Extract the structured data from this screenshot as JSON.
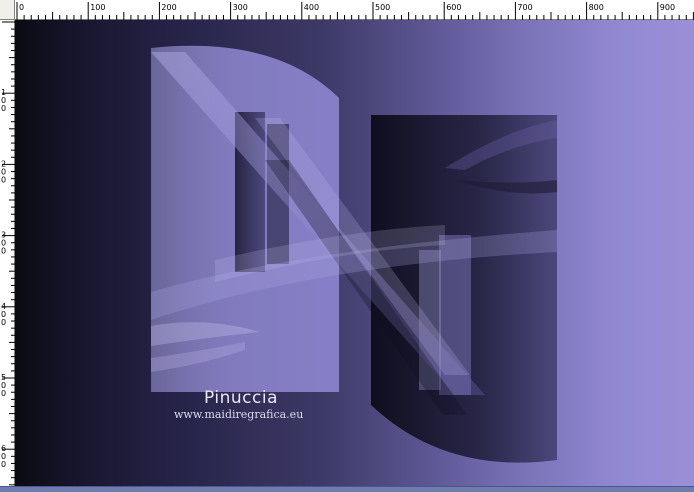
{
  "ruler": {
    "horizontal_labels": [
      "0",
      "100",
      "200",
      "300",
      "400",
      "500",
      "600",
      "700",
      "800",
      "900"
    ],
    "vertical_labels": [
      "1\n0\n0",
      "2\n0\n0",
      "3\n0\n0",
      "4\n0\n0",
      "5\n0\n0",
      "6\n0\n0"
    ]
  },
  "watermark": {
    "name": "Pinuccia",
    "url": "www.maidiregrafica.eu"
  },
  "colors": {
    "canvas_dark": "#0a0a12",
    "canvas_light": "#9b8fd6",
    "shape_light": "#8c84cc",
    "shape_dark": "#14122a"
  }
}
